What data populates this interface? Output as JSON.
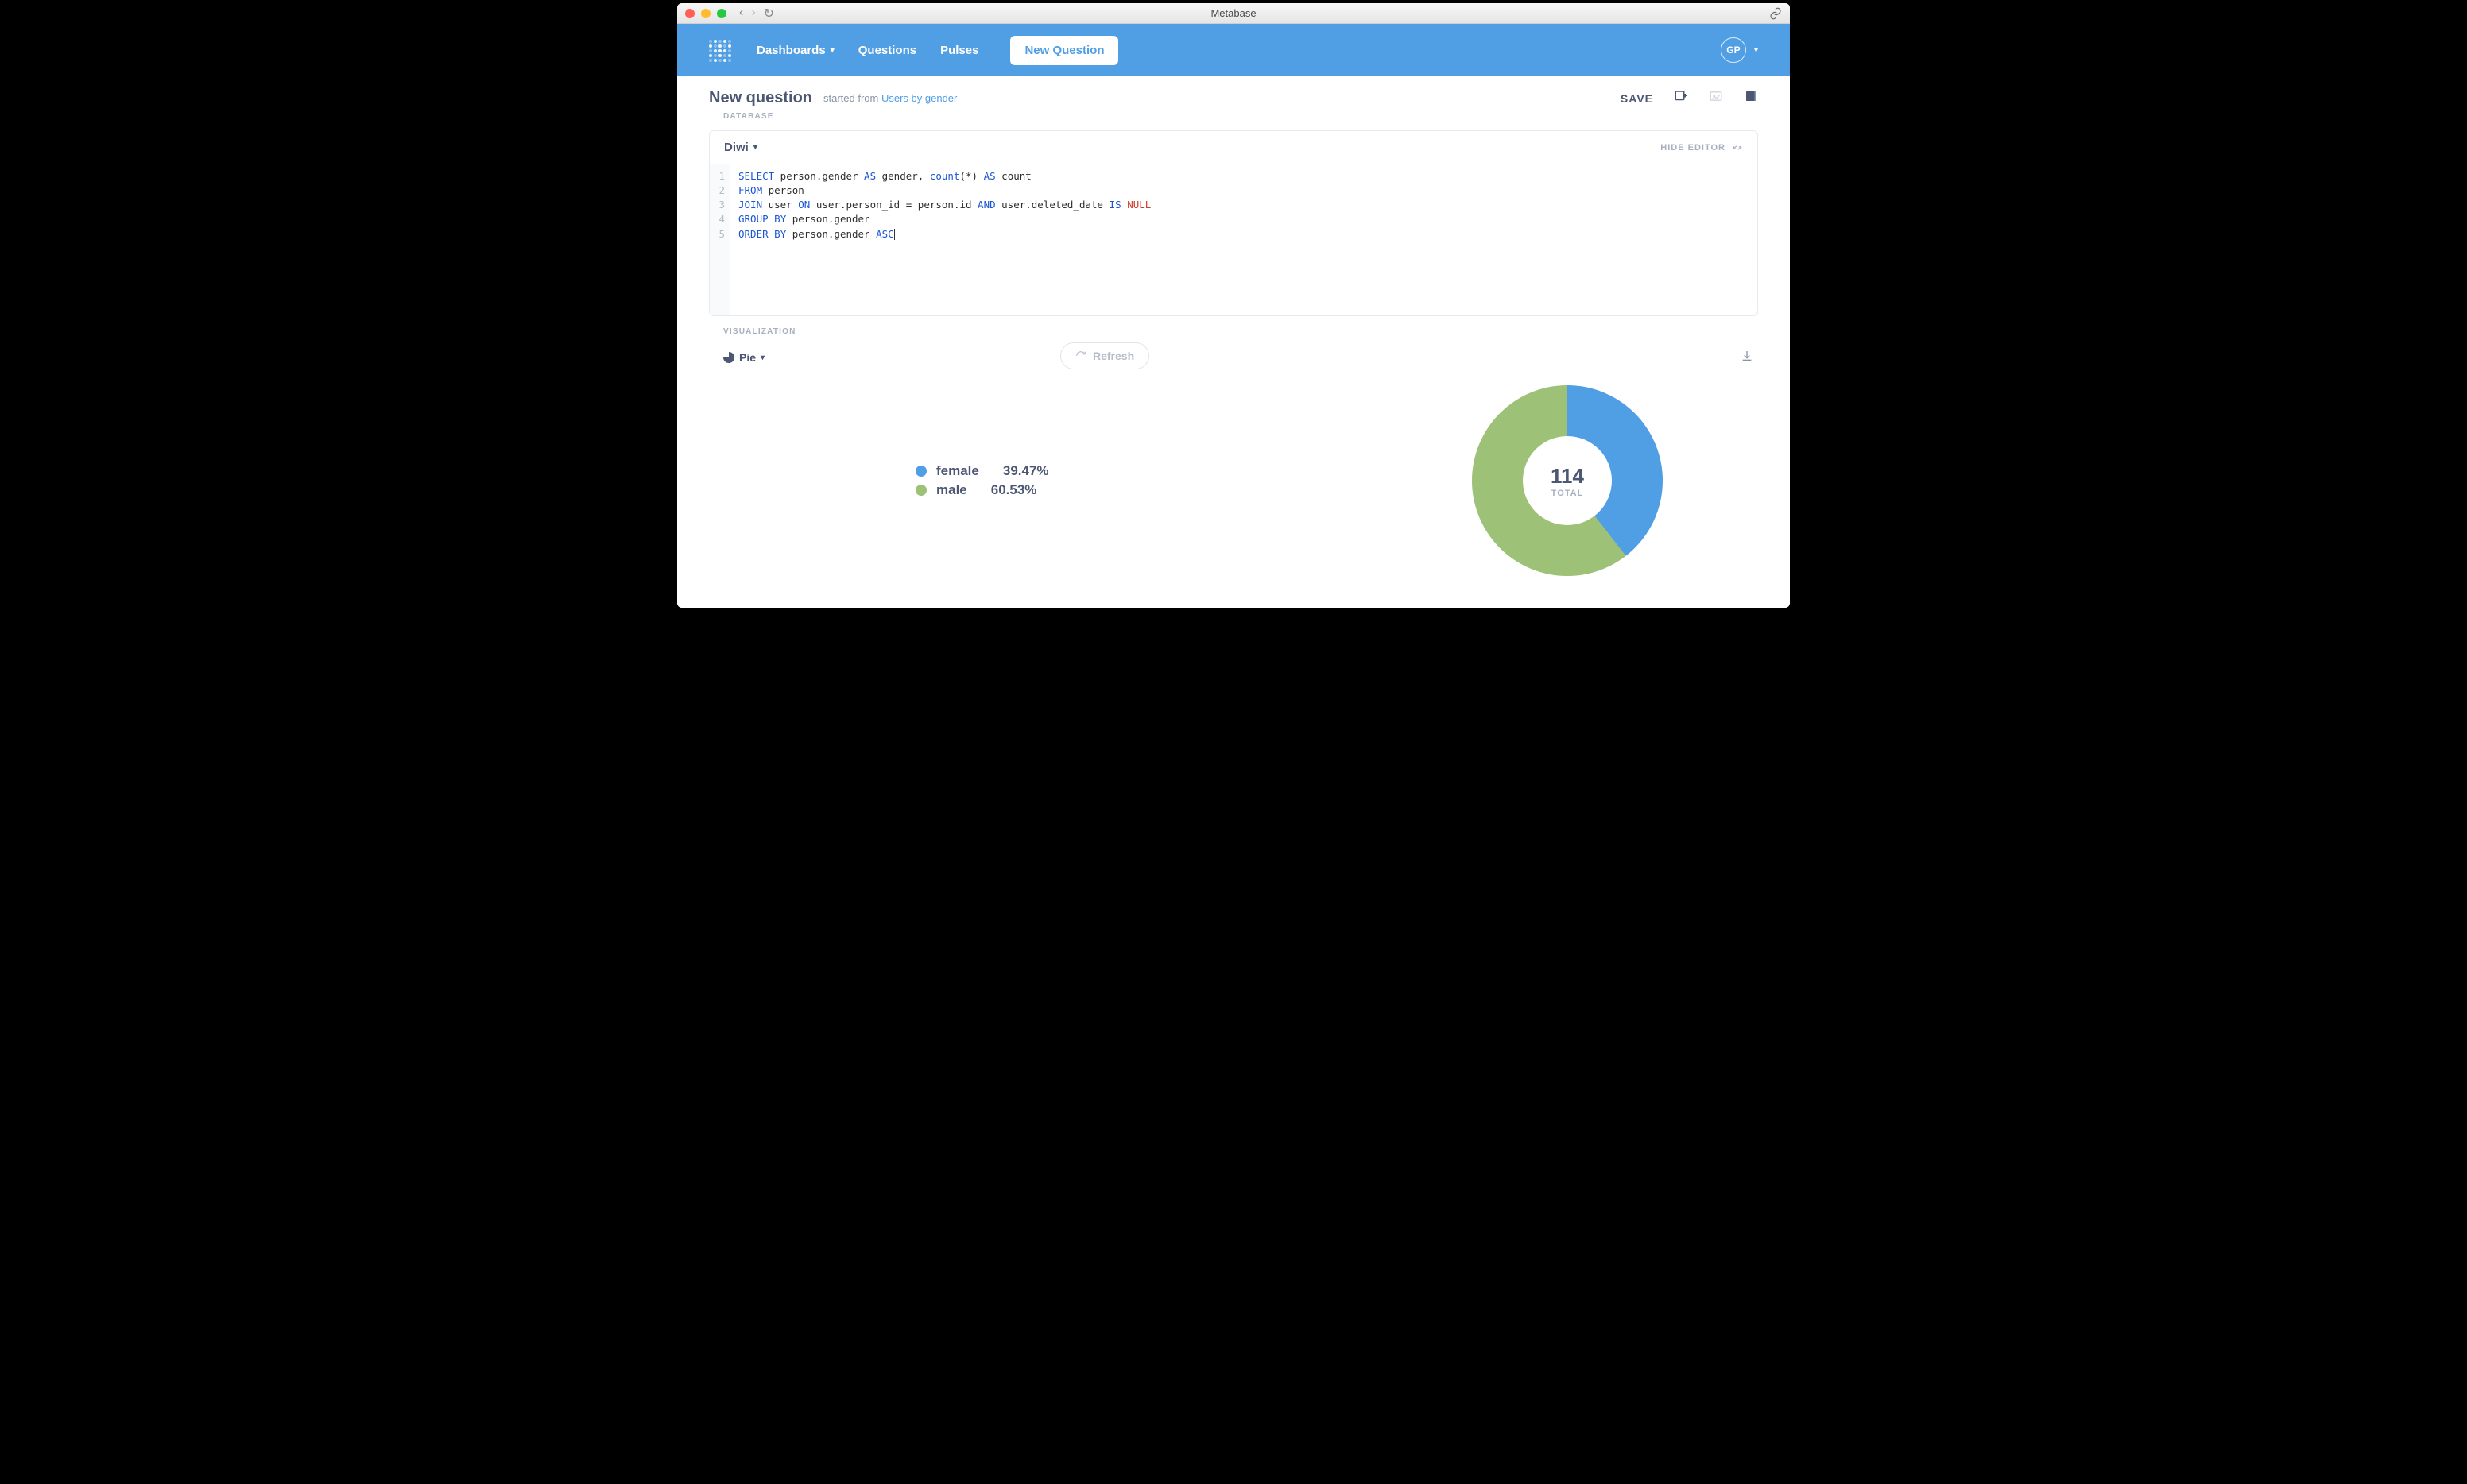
{
  "window": {
    "title": "Metabase"
  },
  "nav": {
    "dashboards": "Dashboards",
    "questions": "Questions",
    "pulses": "Pulses",
    "new_question": "New Question",
    "avatar": "GP"
  },
  "header": {
    "title": "New question",
    "started_from_prefix": "started from ",
    "started_from_link": "Users by gender",
    "save": "SAVE"
  },
  "editor": {
    "section_label": "DATABASE",
    "database": "Diwi",
    "hide_editor": "HIDE EDITOR",
    "sql": {
      "lines": [
        1,
        2,
        3,
        4,
        5
      ],
      "l1_select": "SELECT",
      "l1_txt1": " person.gender ",
      "l1_as1": "AS",
      "l1_txt2": " gender, ",
      "l1_count": "count",
      "l1_txt3": "(*) ",
      "l1_as2": "AS",
      "l1_txt4": " count",
      "l2_from": "FROM",
      "l2_txt": " person",
      "l3_join": "JOIN",
      "l3_txt1": " user ",
      "l3_on": "ON",
      "l3_txt2": " user.person_id = person.id ",
      "l3_and": "AND",
      "l3_txt3": " user.deleted_date ",
      "l3_is": "IS",
      "l3_sp": " ",
      "l3_null": "NULL",
      "l4_group": "GROUP",
      "l4_by": " BY",
      "l4_txt": " person.gender",
      "l5_order": "ORDER",
      "l5_by": " BY",
      "l5_txt": " person.gender ",
      "l5_asc": "ASC"
    }
  },
  "viz": {
    "section_label": "VISUALIZATION",
    "type": "Pie",
    "refresh": "Refresh",
    "total_label": "TOTAL"
  },
  "chart_data": {
    "type": "pie",
    "categories": [
      "female",
      "male"
    ],
    "values": [
      45,
      69
    ],
    "percents": [
      "39.47%",
      "60.53%"
    ],
    "colors": [
      "#509ee3",
      "#9cc177"
    ],
    "total": 114
  },
  "colors": {
    "brand": "#509ee3",
    "accent2": "#9cc177",
    "text": "#4c5773",
    "muted": "#a7b0bf"
  }
}
